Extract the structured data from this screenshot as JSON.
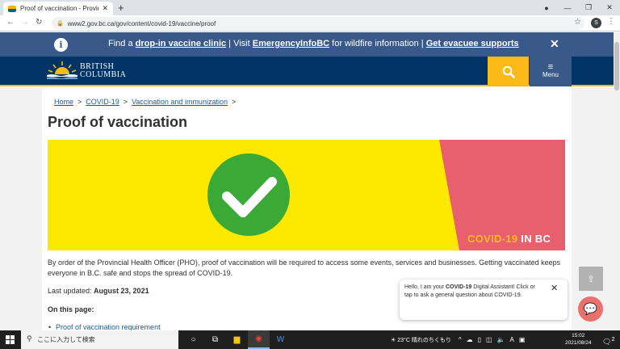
{
  "browser": {
    "tab_title": "Proof of vaccination - Province o",
    "tab_close": "✕",
    "new_tab": "+",
    "url": "www2.gov.bc.ca/gov/content/covid-19/vaccine/proof",
    "profile_initial": "S"
  },
  "alert": {
    "prefix": "Find a ",
    "link1": "drop-in vaccine clinic",
    "mid1": " | Visit ",
    "link2": "EmergencyInfoBC",
    "mid2": " for wildfire information | ",
    "link3": "Get evacuee supports",
    "close": "✕"
  },
  "header": {
    "logo_line1": "BRITISH",
    "logo_line2": "COLUMBIA",
    "menu_label": "Menu"
  },
  "breadcrumb": {
    "home": "Home",
    "covid": "COVID-19",
    "vacc": "Vaccination and immunization",
    "sep": ">"
  },
  "page": {
    "title": "Proof of vaccination",
    "banner_covid": "COVID-19",
    "banner_inbc": "IN BC",
    "intro": "By order of the Provincial Health Officer (PHO), proof of vaccination will be required to access some events, services and businesses. Getting vaccinated keeps everyone in B.C. safe and stops the spread of COVID-19.",
    "updated_label": "Last updated: ",
    "updated_value": "August 23, 2021",
    "on_this_page": "On this page:",
    "toc_first": "Proof of vaccination requirement"
  },
  "chat": {
    "line_prefix": "Hello, I am your ",
    "line_bold": "COVID-19",
    "line_suffix": " Digital Assistant! Click or tap to ask a general question about COVID-19.",
    "close": "✕"
  },
  "taskbar": {
    "search_placeholder": "ここに入力して検索",
    "weather_temp": "23°C",
    "weather_text": "晴れのちくもり",
    "ime": "A",
    "time": "15:02",
    "date": "2021/08/24",
    "notif_count": "2"
  },
  "colors": {
    "bc_blue": "#003366",
    "bc_gold": "#fcba19",
    "banner_yellow": "#fde800",
    "banner_pink": "#e8606e",
    "check_green": "#3ba935"
  }
}
